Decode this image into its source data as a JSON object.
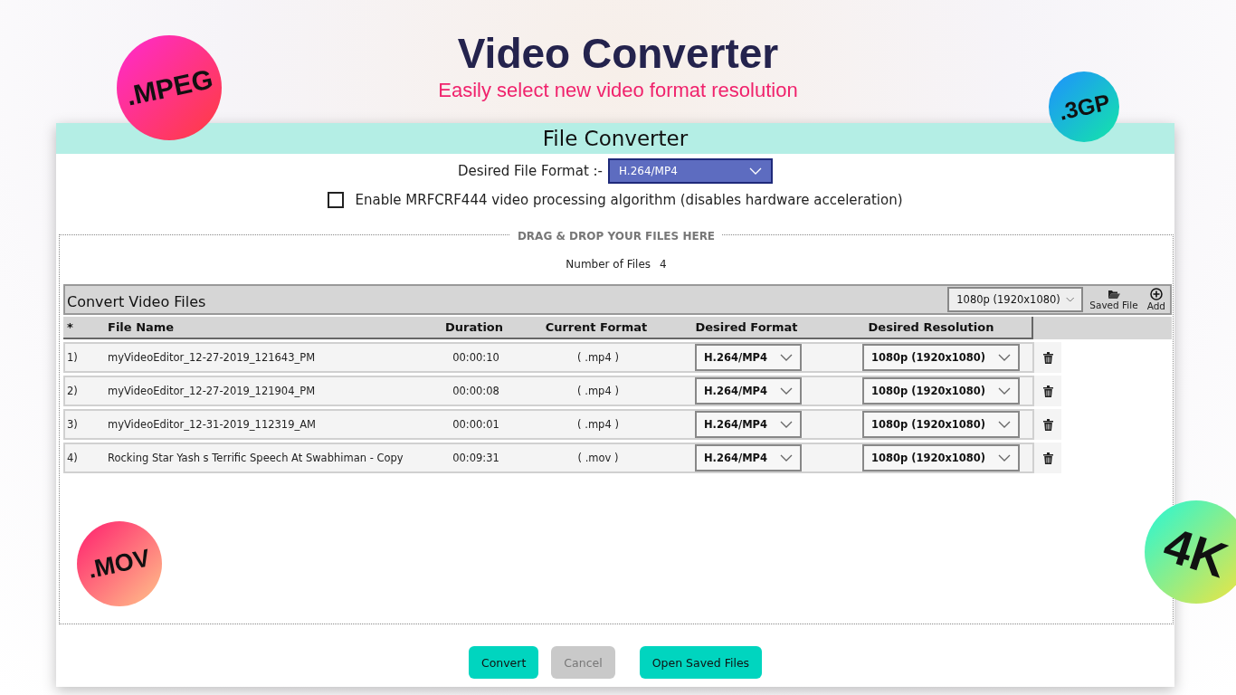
{
  "banner": {
    "title": "Video Converter",
    "subtitle": "Easily select new video format resolution"
  },
  "badges": [
    {
      "text": ".MPEG"
    },
    {
      "text": ".3GP"
    },
    {
      "text": ".MOV"
    },
    {
      "text": "4K"
    }
  ],
  "window": {
    "title": "File Converter"
  },
  "format": {
    "label": "Desired File Format :-",
    "value": "H.264/MP4"
  },
  "option": {
    "label": "Enable MRFCRF444 video processing algorithm (disables hardware acceleration)",
    "checked": false
  },
  "drop_zone": {
    "legend": "DRAG & DROP YOUR FILES HERE"
  },
  "file_count": {
    "label": "Number of Files",
    "value": "4"
  },
  "panel": {
    "title": "Convert Video Files",
    "resolution": "1080p (1920x1080)",
    "tools": [
      {
        "label": "Saved File",
        "kind": "folder"
      },
      {
        "label": "Add",
        "kind": "add"
      }
    ]
  },
  "table": {
    "columns": [
      "*",
      "File Name",
      "Duration",
      "Current Format",
      "Desired Format",
      "Desired Resolution"
    ],
    "rows": [
      {
        "index": "1)",
        "name": "myVideoEditor_12-27-2019_121643_PM",
        "duration": "00:00:10",
        "current": "( .mp4 )",
        "format": "H.264/MP4",
        "resolution": "1080p (1920x1080)"
      },
      {
        "index": "2)",
        "name": "myVideoEditor_12-27-2019_121904_PM",
        "duration": "00:00:08",
        "current": "( .mp4 )",
        "format": "H.264/MP4",
        "resolution": "1080p (1920x1080)"
      },
      {
        "index": "3)",
        "name": "myVideoEditor_12-31-2019_112319_AM",
        "duration": "00:00:01",
        "current": "( .mp4 )",
        "format": "H.264/MP4",
        "resolution": "1080p (1920x1080)"
      },
      {
        "index": "4)",
        "name": "Rocking Star Yash s Terrific Speech At Swabhiman - Copy",
        "duration": "00:09:31",
        "current": "( .mov )",
        "format": "H.264/MP4",
        "resolution": "1080p (1920x1080)"
      }
    ]
  },
  "buttons": [
    {
      "label": "Convert",
      "disabled": false
    },
    {
      "label": "Cancel",
      "disabled": true
    },
    {
      "label": "Open Saved Files",
      "disabled": false
    }
  ]
}
